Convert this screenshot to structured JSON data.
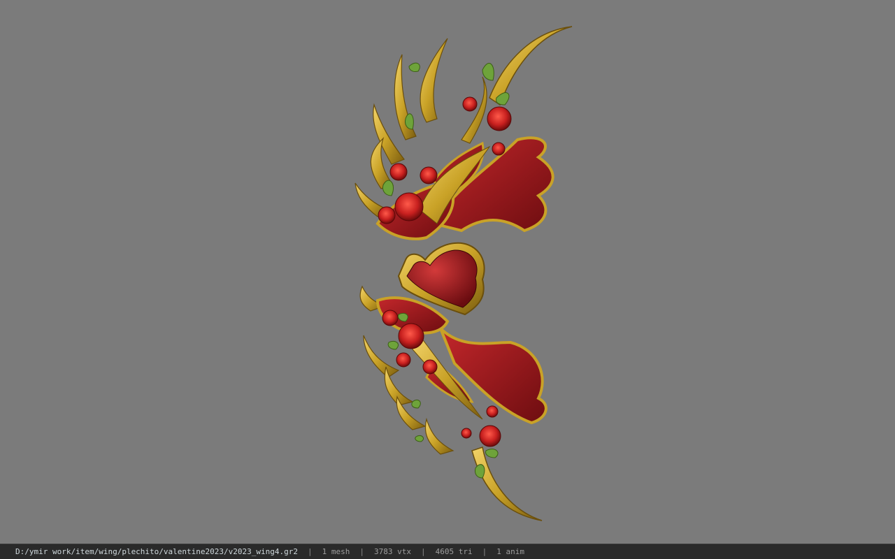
{
  "viewport": {
    "background_color": "#7b7b7b",
    "model_description_icon": "valentine-wing-model"
  },
  "status_bar": {
    "file_path": "D:/ymir work/item/wing/plechito/valentine2023/v2023_wing4.gr2",
    "separator": "|",
    "mesh_count": "1 mesh",
    "vertex_count": "3783 vtx",
    "triangle_count": "4605 tri",
    "anim_count": "1 anim"
  },
  "colors": {
    "gold": "#c9a227",
    "gold_dark": "#7a5c0f",
    "crimson": "#8e1418",
    "rose": "#c8201f",
    "leaf": "#6ea33a"
  }
}
